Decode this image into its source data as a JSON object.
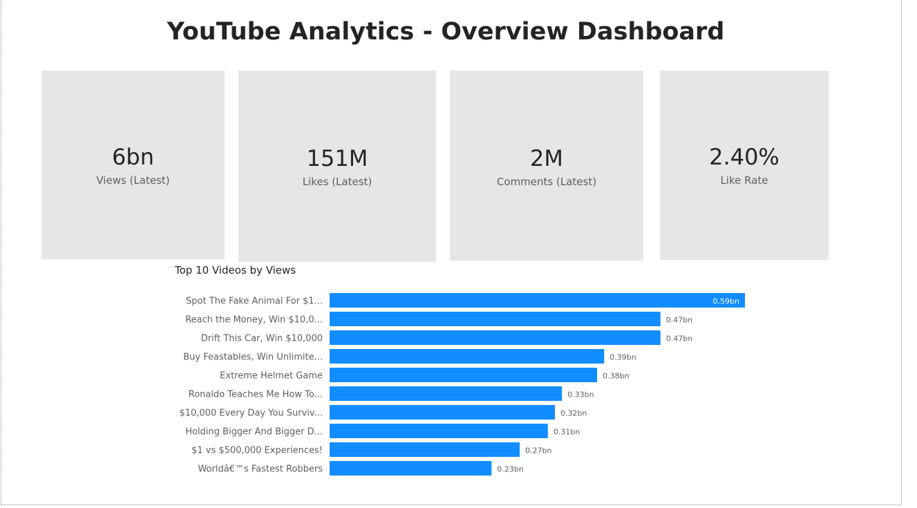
{
  "header": {
    "title": "YouTube Analytics - Overview Dashboard"
  },
  "cards": [
    {
      "value": "6bn",
      "label": "Views (Latest)"
    },
    {
      "value": "151M",
      "label": "Likes (Latest)"
    },
    {
      "value": "2M",
      "label": "Comments (Latest)"
    },
    {
      "value": "2.40%",
      "label": "Like Rate"
    }
  ],
  "colors": {
    "bar": "#118dff",
    "card_bg": "#e6e6e6"
  },
  "chart_data": {
    "type": "bar",
    "orientation": "horizontal",
    "title": "Top 10 Videos by Views",
    "categories": [
      "Spot The Fake Animal For $1...",
      "Reach the Money, Win $10,0...",
      "Drift This Car, Win $10,000",
      "Buy Feastables, Win Unlimite...",
      "Extreme Helmet Game",
      "Ronaldo Teaches Me How To...",
      "$10,000 Every Day You Surviv...",
      "Holding Bigger And Bigger D...",
      "$1 vs $500,000 Experiences!",
      "Worldâ€™s Fastest Robbers"
    ],
    "values": [
      0.59,
      0.47,
      0.47,
      0.39,
      0.38,
      0.33,
      0.32,
      0.31,
      0.27,
      0.23
    ],
    "data_labels": [
      "0.59bn",
      "0.47bn",
      "0.47bn",
      "0.39bn",
      "0.38bn",
      "0.33bn",
      "0.32bn",
      "0.31bn",
      "0.27bn",
      "0.23bn"
    ],
    "xlim": [
      0,
      0.59
    ],
    "grid": false
  }
}
